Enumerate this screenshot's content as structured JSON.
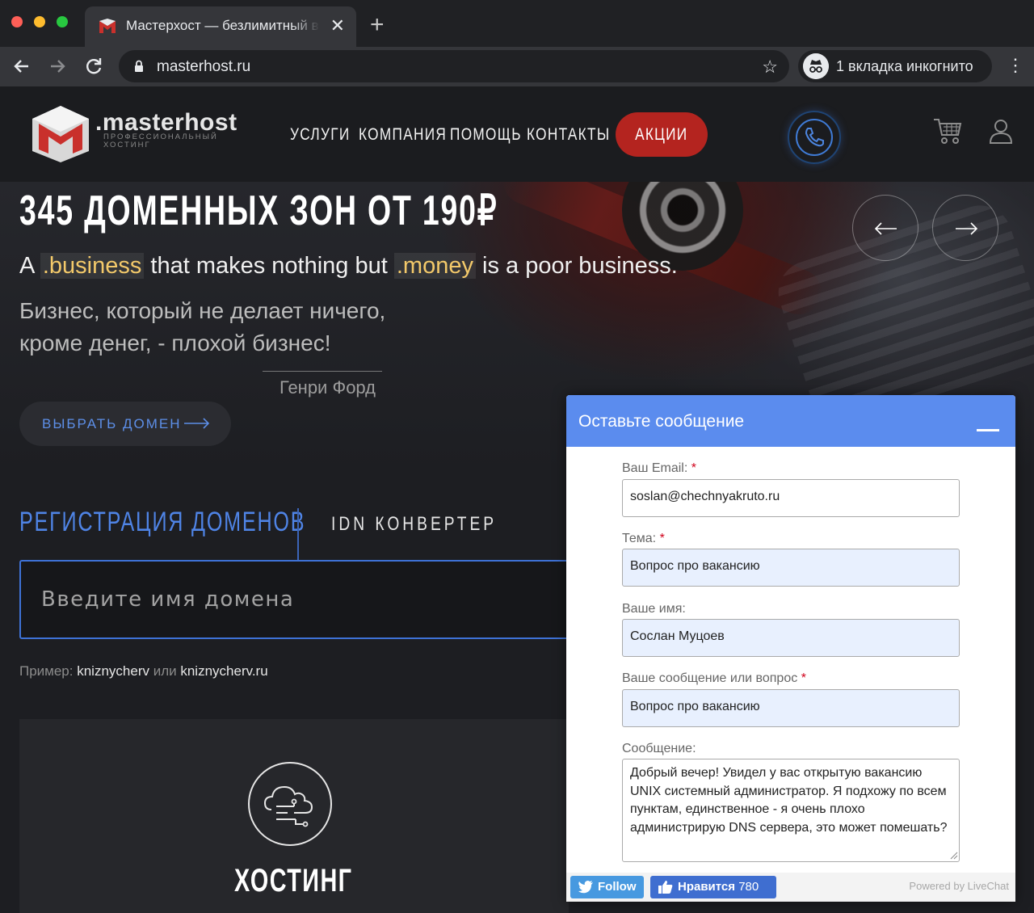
{
  "browser": {
    "tab_title": "Мастерхост — безлимитный виртуальный хостинг",
    "tab_close": "✕",
    "new_tab": "+",
    "url": "masterhost.ru",
    "incognito_label": "1 вкладка инкогнито"
  },
  "header": {
    "logo_name": ".masterhost",
    "logo_sub": "профессиональный хостинг",
    "nav": [
      "УСЛУГИ",
      "КОМПАНИЯ",
      "ПОМОЩЬ",
      "КОНТАКТЫ"
    ],
    "promo": "АКЦИИ"
  },
  "hero": {
    "title": "345 ДОМЕННЫХ ЗОН ОТ 190₽",
    "quote_en_1": "A ",
    "quote_en_hl1": ".business",
    "quote_en_2": " that makes nothing but ",
    "quote_en_hl2": ".money",
    "quote_en_3": " is a poor business.",
    "quote_ru": "Бизнес, который не делает ничего, кроме денег, - плохой бизнес!",
    "author": "Генри Форд",
    "button": "ВЫБРАТЬ ДОМЕН"
  },
  "domains": {
    "tab_register": "РЕГИСТРАЦИЯ ДОМЕНОВ",
    "tab_idn": "IDN КОНВЕРТЕР",
    "input_placeholder": "Введите имя домена",
    "example_prefix": "Пример: ",
    "example_1": "kniznycherv",
    "example_or": " или ",
    "example_2": "kniznycherv.ru"
  },
  "card": {
    "title": "ХОСТИНГ"
  },
  "chat": {
    "title": "Оставьте сообщение",
    "email_label": "Ваш Email:",
    "email_value": "soslan@chechnyakruto.ru",
    "subject_label": "Тема:",
    "subject_value": "Вопрос про вакансию",
    "name_label": "Ваше имя:",
    "name_value": "Сослан Муцоев",
    "question_label": "Ваше сообщение или вопрос",
    "question_value": "Вопрос про вакансию",
    "message_label": "Сообщение:",
    "message_value": "Добрый вечер! Увидел у вас открытую вакансию UNIX системный администратор. Я подхожу по всем пунктам, единственное - я очень плохо администрирую DNS сервера, это может помешать?",
    "required_mark": "*",
    "follow": "Follow",
    "like": "Нравится",
    "like_count": "780",
    "powered": "Powered by LiveChat"
  },
  "colors": {
    "accent_blue": "#4f84e6",
    "promo_red": "#b4241f",
    "chat_header": "#5b8cee"
  }
}
